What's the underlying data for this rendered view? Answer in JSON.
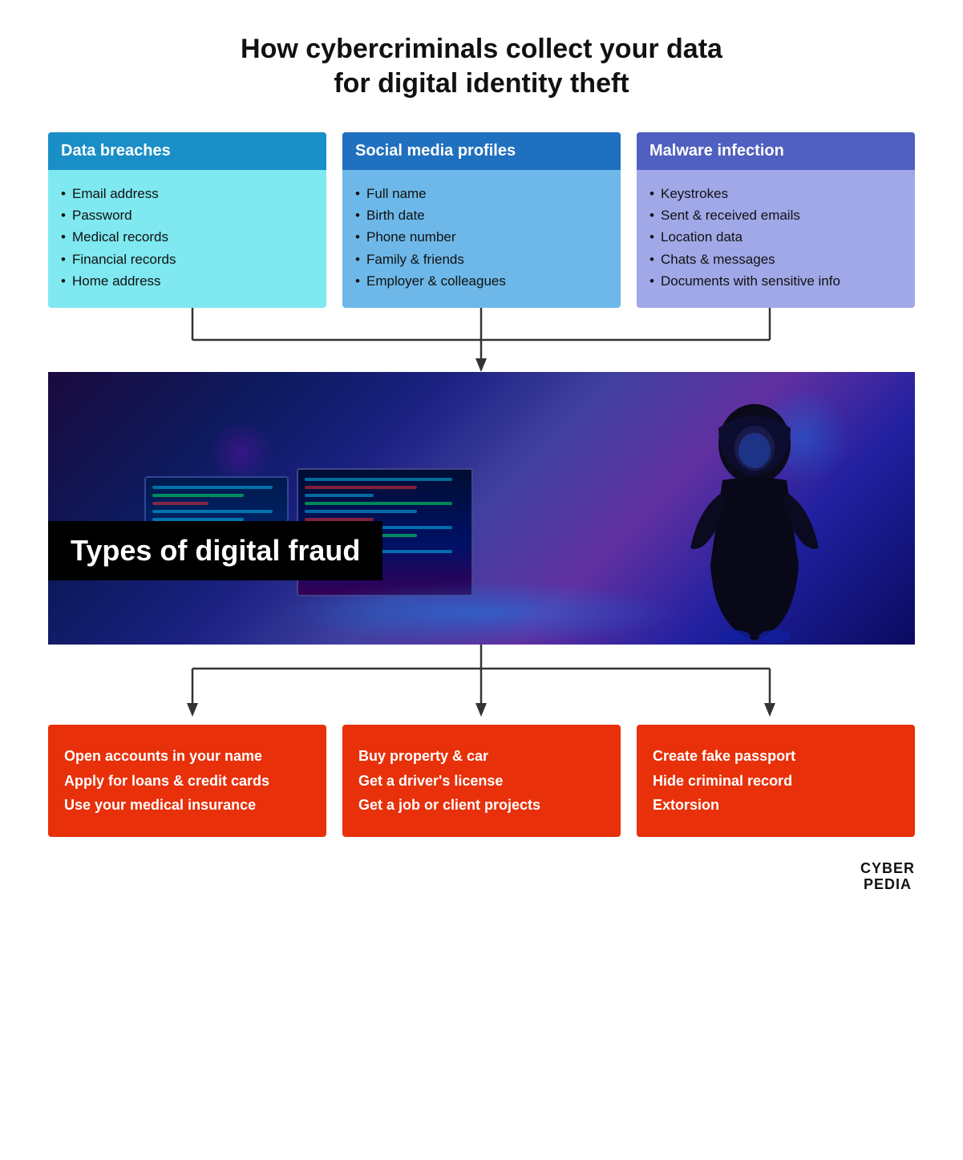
{
  "title": {
    "line1": "How cybercriminals collect your data",
    "line2": "for digital identity theft"
  },
  "top_boxes": [
    {
      "id": "data-breaches",
      "header": "Data breaches",
      "items": [
        "Email address",
        "Password",
        "Medical records",
        "Financial records",
        "Home address"
      ]
    },
    {
      "id": "social-media",
      "header": "Social media profiles",
      "items": [
        "Full name",
        "Birth date",
        "Phone number",
        "Family & friends",
        "Employer & colleagues"
      ]
    },
    {
      "id": "malware",
      "header": "Malware infection",
      "items": [
        "Keystrokes",
        "Sent & received emails",
        "Location data",
        "Chats & messages",
        "Documents with sensitive info"
      ]
    }
  ],
  "fraud_label": "Types of digital fraud",
  "bottom_boxes": [
    {
      "id": "financial-fraud",
      "items": [
        "Open accounts in your name",
        "Apply for loans & credit cards",
        "Use your medical insurance"
      ]
    },
    {
      "id": "identity-fraud",
      "items": [
        "Buy property & car",
        "Get a driver's license",
        "Get a job or client projects"
      ]
    },
    {
      "id": "document-fraud",
      "items": [
        "Create fake passport",
        "Hide criminal record",
        "Extorsion"
      ]
    }
  ],
  "logo": {
    "line1": "CYBER",
    "line2": "PEDIA"
  }
}
